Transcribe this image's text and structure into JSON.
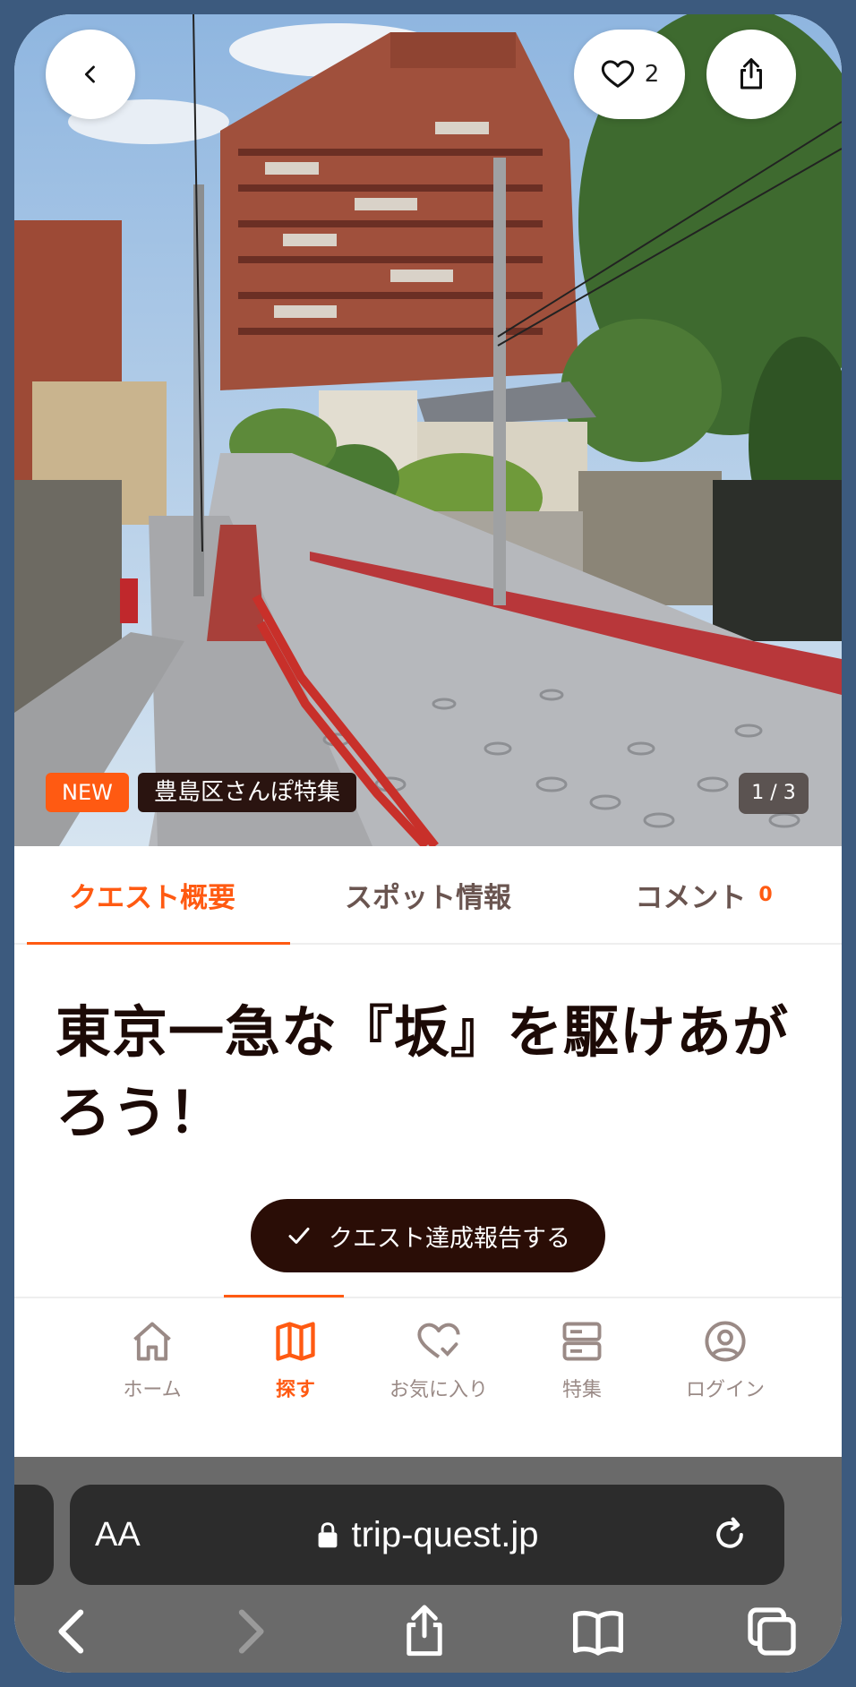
{
  "hero": {
    "like_count": "2",
    "badge_new": "NEW",
    "badge_category": "豊島区さんぽ特集",
    "image_counter": "1 / 3"
  },
  "tabs": [
    {
      "label": "クエスト概要",
      "active": true
    },
    {
      "label": "スポット情報",
      "active": false
    },
    {
      "label": "コメント",
      "count": "0",
      "active": false
    }
  ],
  "quest": {
    "title": "東京一急な『坂』を駆けあがろう！",
    "report_button": "クエスト達成報告する"
  },
  "bottom_nav": [
    {
      "label": "ホーム",
      "icon": "home-icon"
    },
    {
      "label": "探す",
      "icon": "map-icon",
      "active": true
    },
    {
      "label": "お気に入り",
      "icon": "heart-check-icon"
    },
    {
      "label": "特集",
      "icon": "feature-list-icon"
    },
    {
      "label": "ログイン",
      "icon": "user-circle-icon"
    }
  ],
  "browser": {
    "text_size_label": "AA",
    "url": "trip-quest.jp"
  },
  "colors": {
    "accent": "#ff5a12",
    "dark": "#2a0d06",
    "frame": "#3c5a7e"
  }
}
